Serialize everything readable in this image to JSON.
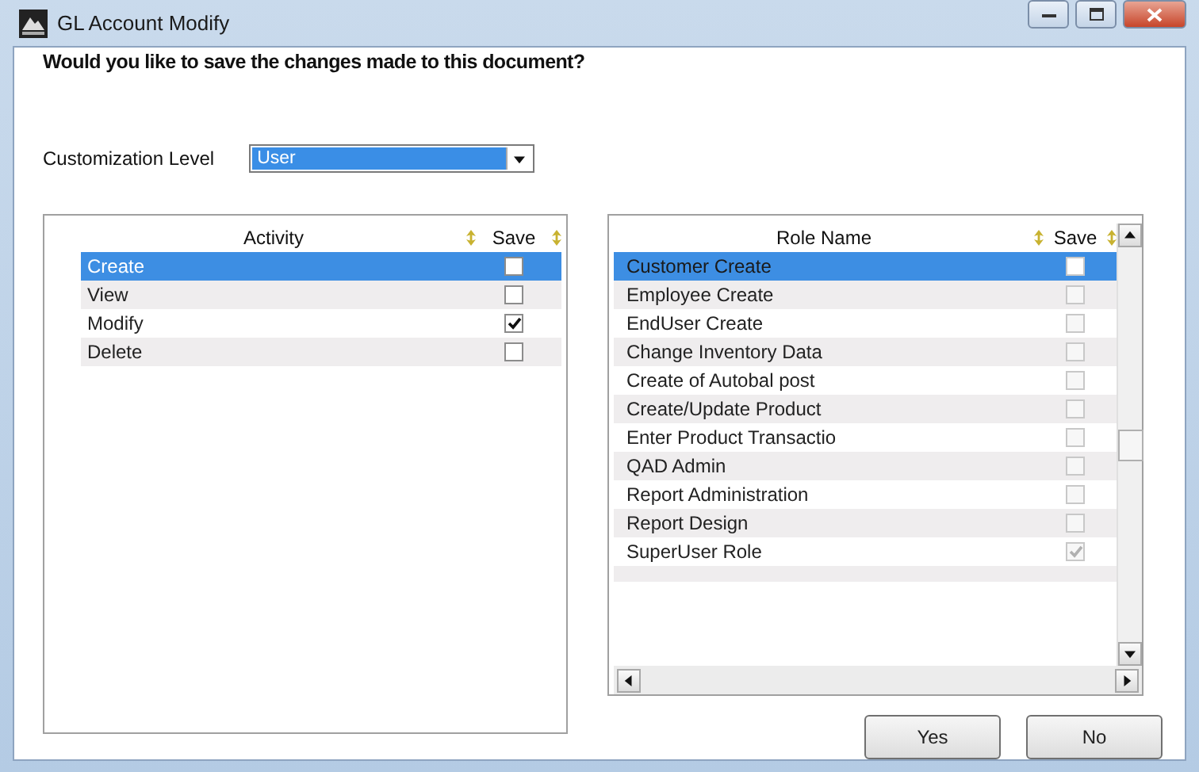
{
  "window": {
    "title": "GL Account Modify"
  },
  "prompt": "Would you like to save the changes made to this document?",
  "customization_level": {
    "label": "Customization Level",
    "value": "User"
  },
  "activity_table": {
    "columns": [
      "Activity",
      "Save"
    ],
    "rows": [
      {
        "activity": "Create",
        "save": false,
        "selected": true
      },
      {
        "activity": "View",
        "save": false,
        "selected": false
      },
      {
        "activity": "Modify",
        "save": true,
        "selected": false
      },
      {
        "activity": "Delete",
        "save": false,
        "selected": false
      }
    ]
  },
  "role_table": {
    "columns": [
      "Role Name",
      "Save"
    ],
    "rows": [
      {
        "role": "Customer Create",
        "save": false,
        "selected": true,
        "disabled": true
      },
      {
        "role": "Employee Create",
        "save": false,
        "selected": false,
        "disabled": true
      },
      {
        "role": "EndUser Create",
        "save": false,
        "selected": false,
        "disabled": true
      },
      {
        "role": "Change Inventory Data",
        "save": false,
        "selected": false,
        "disabled": true
      },
      {
        "role": "Create of Autobal post",
        "save": false,
        "selected": false,
        "disabled": true
      },
      {
        "role": "Create/Update Product",
        "save": false,
        "selected": false,
        "disabled": true
      },
      {
        "role": "Enter Product Transactio",
        "save": false,
        "selected": false,
        "disabled": true
      },
      {
        "role": "QAD Admin",
        "save": false,
        "selected": false,
        "disabled": true
      },
      {
        "role": "Report Administration",
        "save": false,
        "selected": false,
        "disabled": true
      },
      {
        "role": "Report Design",
        "save": false,
        "selected": false,
        "disabled": true
      },
      {
        "role": "SuperUser Role",
        "save": true,
        "selected": false,
        "disabled": true
      }
    ]
  },
  "buttons": [
    "Yes",
    "No"
  ]
}
